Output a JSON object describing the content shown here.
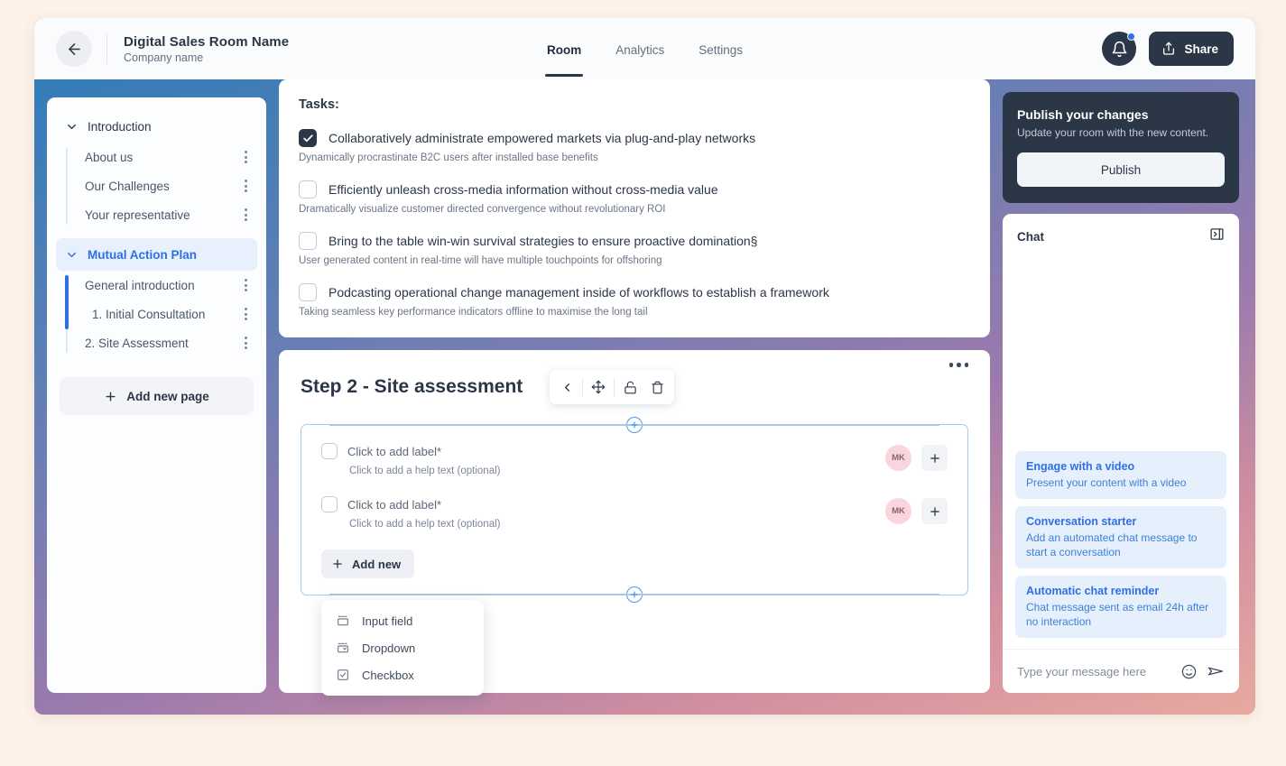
{
  "header": {
    "back_icon": "arrow-left-icon",
    "room_title": "Digital Sales Room Name",
    "company_name": "Company name",
    "tabs": [
      {
        "label": "Room",
        "active": true
      },
      {
        "label": "Analytics",
        "active": false
      },
      {
        "label": "Settings",
        "active": false
      }
    ],
    "bell_icon": "bell-icon",
    "share_label": "Share",
    "share_icon": "share-icon"
  },
  "sidebar": {
    "groups": [
      {
        "label": "Introduction",
        "active": false,
        "items": [
          {
            "label": "About us"
          },
          {
            "label": "Our Challenges"
          },
          {
            "label": "Your representative"
          }
        ]
      },
      {
        "label": "Mutual Action Plan",
        "active": true,
        "items": [
          {
            "label": "General introduction"
          },
          {
            "label": "1. Initial Consultation"
          },
          {
            "label": "2. Site Assessment"
          }
        ]
      }
    ],
    "add_page_label": "Add new page"
  },
  "tasks": {
    "title": "Tasks:",
    "items": [
      {
        "checked": true,
        "label": "Collaboratively administrate empowered markets via plug-and-play networks",
        "help": "Dynamically procrastinate B2C users after installed base benefits"
      },
      {
        "checked": false,
        "label": "Efficiently unleash cross-media information without cross-media value",
        "help": "Dramatically visualize customer directed convergence without revolutionary ROI"
      },
      {
        "checked": false,
        "label": "Bring to the table win-win survival strategies to ensure proactive domination§",
        "help": "User generated content in real-time will have multiple touchpoints for offshoring"
      },
      {
        "checked": false,
        "label": "Podcasting operational change management inside of workflows to establish a framework",
        "help": "Taking seamless key performance indicators offline to maximise the long tail"
      }
    ]
  },
  "step": {
    "title": "Step 2 - Site assessment",
    "toolbar": [
      {
        "icon": "chevron-left-icon",
        "name": "collapse-button"
      },
      {
        "icon": "move-icon",
        "name": "drag-move-button"
      },
      {
        "icon": "unlock-icon",
        "name": "unlock-button"
      },
      {
        "icon": "trash-icon",
        "name": "delete-button"
      }
    ],
    "more_icon": "more-horizontal-icon",
    "fields": [
      {
        "label": "Click to add label*",
        "help": "Click to add a help text (optional)",
        "avatar": "MK"
      },
      {
        "label": "Click to add label*",
        "help": "Click to add a help text (optional)",
        "avatar": "MK"
      }
    ],
    "add_new_label": "Add new",
    "dropdown_options": [
      {
        "label": "Input field",
        "icon": "input-field-icon"
      },
      {
        "label": "Dropdown",
        "icon": "dropdown-icon"
      },
      {
        "label": "Checkbox",
        "icon": "checkbox-icon"
      }
    ]
  },
  "publish": {
    "title": "Publish your changes",
    "subtitle": "Update your room with the new content.",
    "button_label": "Publish"
  },
  "chat": {
    "title": "Chat",
    "collapse_icon": "panel-collapse-icon",
    "suggestions": [
      {
        "title": "Engage with a video",
        "desc": "Present your content with a video"
      },
      {
        "title": "Conversation starter",
        "desc": "Add an automated chat message to start a conversation"
      },
      {
        "title": "Automatic chat reminder",
        "desc": "Chat message sent as email 24h after no interaction"
      }
    ],
    "input_placeholder": "Type your message here",
    "emoji_icon": "smiley-icon",
    "send_icon": "send-icon"
  },
  "colors": {
    "accent_blue": "#2f6fe4",
    "dark_navy": "#2b3647",
    "page_bg": "#fdf2e9",
    "avatar_pink": "#fbd5dd"
  }
}
